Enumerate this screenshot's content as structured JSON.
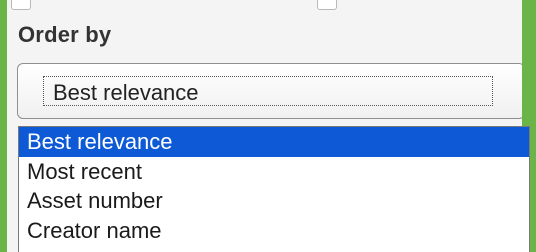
{
  "order_by": {
    "label": "Order by",
    "selected_value": "Best relevance",
    "options": [
      {
        "label": "Best relevance",
        "selected": true
      },
      {
        "label": "Most recent",
        "selected": false
      },
      {
        "label": "Asset number",
        "selected": false
      },
      {
        "label": "Creator name",
        "selected": false
      }
    ]
  },
  "colors": {
    "background_green": "#6bb548",
    "panel": "#f4f4f4",
    "selected_option": "#0e5ad6"
  }
}
